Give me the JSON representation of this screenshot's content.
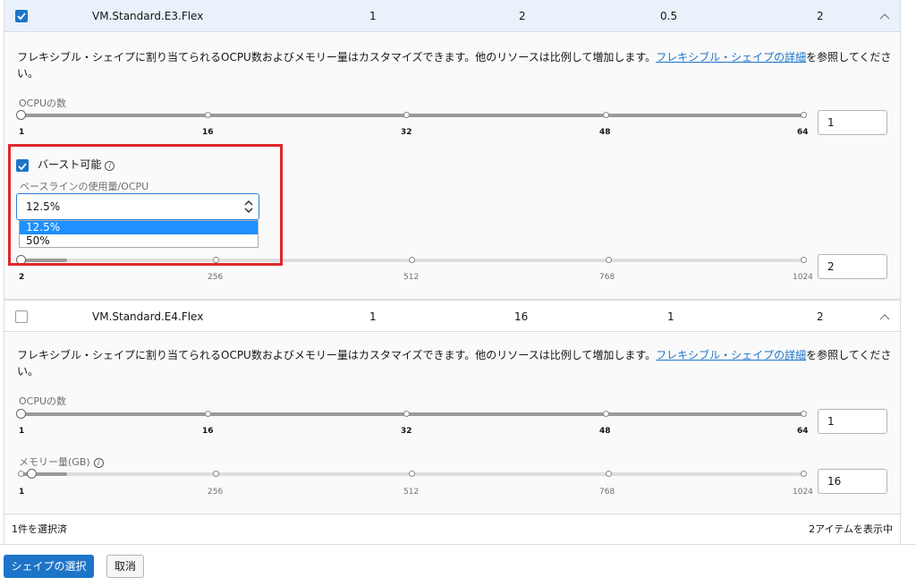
{
  "shapes": [
    {
      "name": "VM.Standard.E3.Flex",
      "ocpu": "1",
      "memory": "2",
      "network": "0.5",
      "vnics": "2",
      "selected": true,
      "description": "フレキシブル・シェイプに割り当てられるOCPU数およびメモリー量はカスタマイズできます。他のリソースは比例して増加します。",
      "desc_link": "フレキシブル・シェイプの詳細",
      "desc_tail": "を参照してくださ",
      "desc_tail2": "い。",
      "ocpu_label": "OCPUの数",
      "ocpu_ticks": [
        "1",
        "16",
        "32",
        "48",
        "64"
      ],
      "ocpu_value": "1",
      "burst_label": "バースト可能",
      "baseline_label": "ベースラインの使用量/OCPU",
      "baseline_value": "12.5%",
      "baseline_options": [
        "12.5%",
        "50%"
      ],
      "mem_ticks": [
        "2",
        "256",
        "512",
        "768",
        "1024"
      ],
      "mem_value": "2"
    },
    {
      "name": "VM.Standard.E4.Flex",
      "ocpu": "1",
      "memory": "16",
      "network": "1",
      "vnics": "2",
      "selected": false,
      "description": "フレキシブル・シェイプに割り当てられるOCPU数およびメモリー量はカスタマイズできます。他のリソースは比例して増加します。",
      "desc_link": "フレキシブル・シェイプの詳細",
      "desc_tail": "を参照してくださ",
      "desc_tail2": "い。",
      "ocpu_label": "OCPUの数",
      "ocpu_ticks": [
        "1",
        "16",
        "32",
        "48",
        "64"
      ],
      "ocpu_value": "1",
      "mem_label": "メモリー量(GB)",
      "mem_ticks": [
        "1",
        "256",
        "512",
        "768",
        "1024"
      ],
      "mem_value": "16"
    }
  ],
  "footer": {
    "selected_count": "1件を選択済",
    "items_shown": "2アイテムを表示中"
  },
  "actions": {
    "select_shape": "シェイプの選択",
    "cancel": "取消"
  },
  "colors": {
    "accent": "#1d74c8",
    "highlight": "#e0262b",
    "selected_row": "#e9f2fb"
  }
}
